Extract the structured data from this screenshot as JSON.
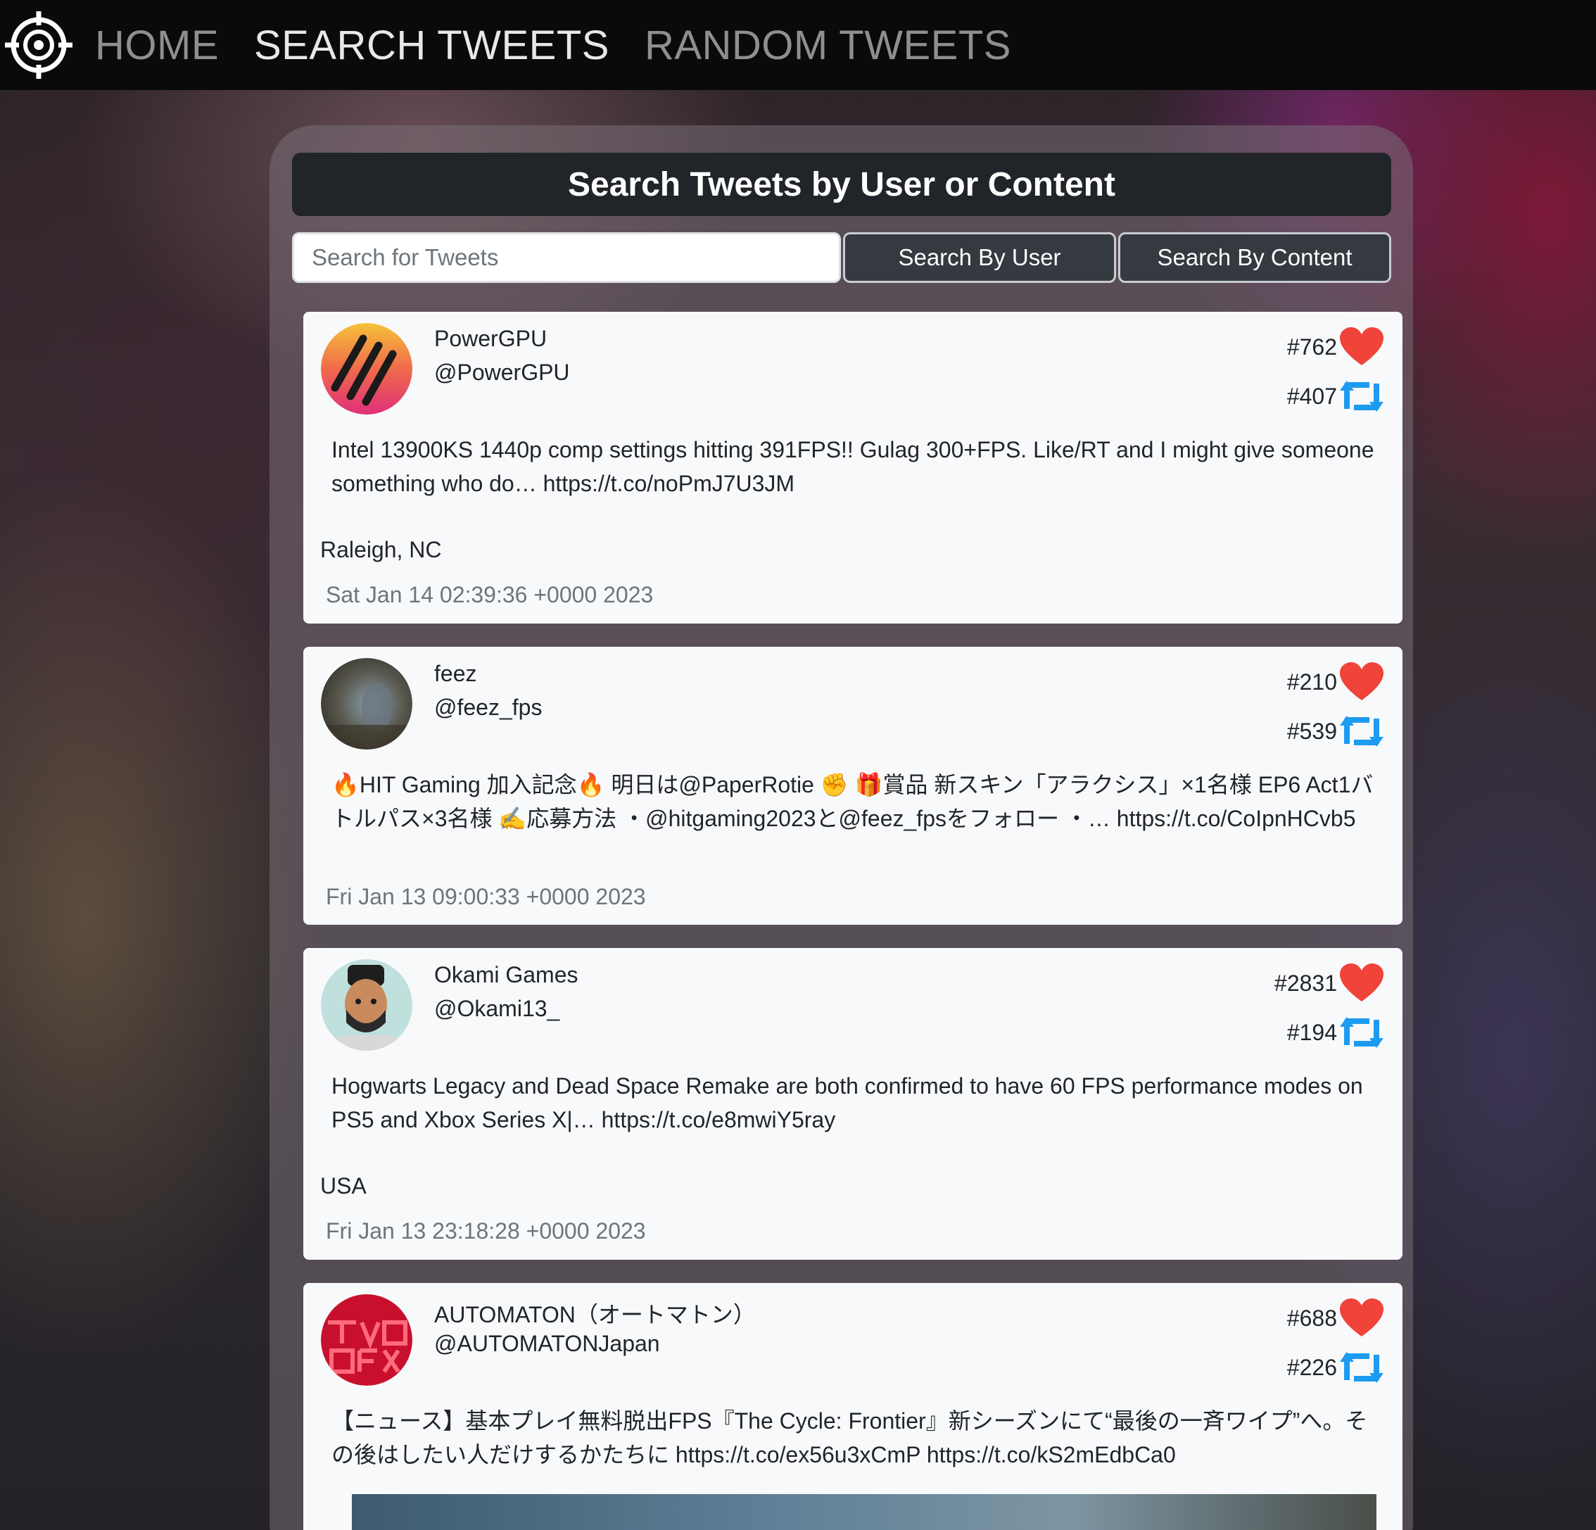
{
  "nav": {
    "logo_icon": "crosshair-icon",
    "links": [
      {
        "label": "HOME",
        "active": false
      },
      {
        "label": "SEARCH TWEETS",
        "active": true
      },
      {
        "label": "RANDOM TWEETS",
        "active": false
      }
    ]
  },
  "search": {
    "title": "Search Tweets by User or Content",
    "placeholder": "Search for Tweets",
    "value": "",
    "by_user_label": "Search By User",
    "by_content_label": "Search By Content"
  },
  "colors": {
    "heart": "#f0433a",
    "retweet": "#1d9bf0",
    "navbar": "#0a0a0a",
    "title_bar": "#212529"
  },
  "tweets": [
    {
      "name": "PowerGPU",
      "handle": "@PowerGPU",
      "likes": "#762",
      "retweets": "#407",
      "text": "Intel 13900KS 1440p comp settings hitting 391FPS!! Gulag 300+FPS. Like/RT and I might give someone something who do… https://t.co/noPmJ7U3JM",
      "location": "Raleigh, NC",
      "date": "Sat Jan 14 02:39:36 +0000 2023"
    },
    {
      "name": "feez",
      "handle": "@feez_fps",
      "likes": "#210",
      "retweets": "#539",
      "text": "🔥HIT Gaming 加入記念🔥 明日は@PaperRotie ✊ 🎁賞品 新スキン「アラクシス」×1名様 EP6 Act1バトルパス×3名様 ✍️応募方法 ・@hitgaming2023と@feez_fpsをフォロー ・… https://t.co/CoIpnHCvb5",
      "location": "",
      "date": "Fri Jan 13 09:00:33 +0000 2023"
    },
    {
      "name": "Okami Games",
      "handle": "@Okami13_",
      "likes": "#2831",
      "retweets": "#194",
      "text": "Hogwarts Legacy and Dead Space Remake are both confirmed to have 60 FPS performance modes on PS5 and Xbox Series X|… https://t.co/e8mwiY5ray",
      "location": "USA",
      "date": "Fri Jan 13 23:18:28 +0000 2023"
    },
    {
      "name": "AUTOMATON（オートマトン）",
      "handle": "@AUTOMATONJapan",
      "likes": "#688",
      "retweets": "#226",
      "text": "【ニュース】基本プレイ無料脱出FPS『The Cycle: Frontier』新シーズンにて“最後の一斉ワイプ”へ。その後はしたい人だけするかたちに https://t.co/ex56u3xCmP https://t.co/kS2mEdbCa0",
      "location": "",
      "date": ""
    }
  ]
}
